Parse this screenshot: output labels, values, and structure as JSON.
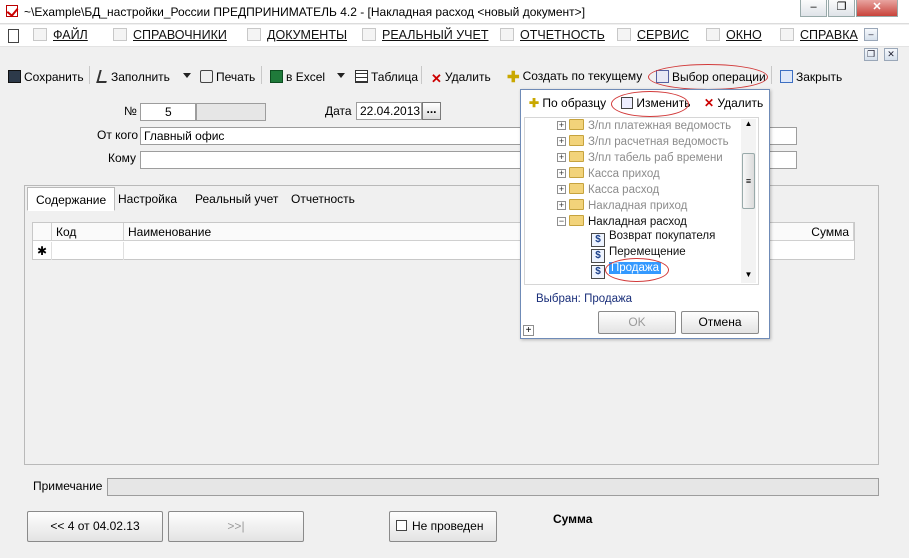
{
  "window": {
    "title": "~\\Example\\БД_настройки_России  ПРЕДПРИНИМАТЕЛЬ 4.2 - [Накладная расход <новый документ>]",
    "minimize": "–",
    "restore": "❐",
    "close": "✕"
  },
  "menu": {
    "items": [
      {
        "label": "ФАЙЛ"
      },
      {
        "label": "СПРАВОЧНИКИ"
      },
      {
        "label": "ДОКУМЕНТЫ"
      },
      {
        "label": "РЕАЛЬНЫЙ УЧЕТ"
      },
      {
        "label": "ОТЧЕТНОСТЬ"
      },
      {
        "label": "СЕРВИС"
      },
      {
        "label": "ОКНО"
      },
      {
        "label": "СПРАВКА"
      }
    ],
    "mdi_minimize": "–",
    "mdi_restore": "❐",
    "mdi_close": "✕"
  },
  "toolbar": {
    "save": "Сохранить",
    "fill": "Заполнить",
    "print": "Печать",
    "excel": "в Excel",
    "table": "Таблица",
    "delete": "Удалить",
    "create_from_current": "Создать по текущему",
    "select_operation": "Выбор операции",
    "close": "Закрыть"
  },
  "form": {
    "number_label": "№",
    "number_value": "5",
    "date_label": "Дата",
    "date_value": "22.04.2013",
    "date_button": "...",
    "from_label": "От кого",
    "from_value": "Главный офис",
    "to_label": "Кому",
    "to_value": ""
  },
  "tabs": [
    {
      "label": "Содержание",
      "active": true
    },
    {
      "label": "Настройка"
    },
    {
      "label": "Реальный учет"
    },
    {
      "label": "Отчетность"
    }
  ],
  "grid": {
    "columns": [
      "Код",
      "Наименование",
      "Сумма"
    ],
    "new_row_marker": "✱"
  },
  "footer": {
    "note_label": "Примечание",
    "note_value": "",
    "prev_button": "<< 4 от 04.02.13",
    "next_button": ">>|",
    "status_checkbox": "Не проведен",
    "status_checked": false,
    "sum_label": "Сумма"
  },
  "popup": {
    "toolbar": {
      "by_sample": "По образцу",
      "edit": "Изменить",
      "delete": "Удалить"
    },
    "tree": [
      {
        "label": "З/пл платежная ведомость",
        "type": "folder",
        "expander": "+"
      },
      {
        "label": "З/пл расчетная ведомость",
        "type": "folder",
        "expander": "+"
      },
      {
        "label": "З/пл табель раб времени",
        "type": "folder",
        "expander": "+"
      },
      {
        "label": "Касса приход",
        "type": "folder",
        "expander": "+"
      },
      {
        "label": "Касса расход",
        "type": "folder",
        "expander": "+"
      },
      {
        "label": "Накладная приход",
        "type": "folder",
        "expander": "+"
      },
      {
        "label": "Накладная расход",
        "type": "folder",
        "expander": "−"
      },
      {
        "label": "Возврат покупателя",
        "type": "operation",
        "icon": "$"
      },
      {
        "label": "Перемещение",
        "type": "operation",
        "icon": "$"
      },
      {
        "label": "Продажа",
        "type": "operation",
        "icon": "$",
        "selected": true
      }
    ],
    "selected_label": "Выбран:",
    "selected_value": "Продажа",
    "ok_button": "OK",
    "cancel_button": "Отмена",
    "corner_plus": "+",
    "scroll_up": "▲",
    "scroll_down": "▼"
  },
  "colors": {
    "highlight": "#3399ff",
    "annotation": "#d23a3a",
    "link": "#1a2f7a"
  }
}
